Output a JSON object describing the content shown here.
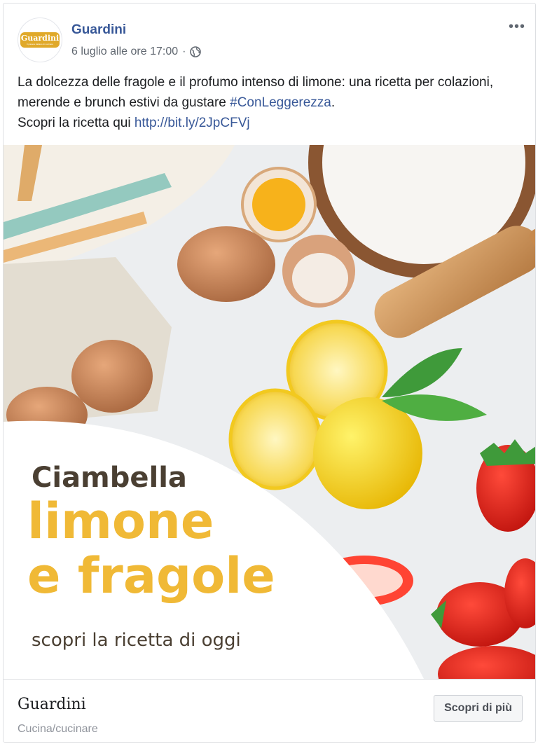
{
  "post": {
    "page_name": "Guardini",
    "timestamp": "6 luglio alle ore 17:00",
    "separator": "·",
    "more_label": "•••",
    "text_main": "La dolcezza delle fragole e il profumo intenso di limone: una ricetta per colazioni, merende e brunch estivi da gustare ",
    "hashtag": "#ConLeggerezza",
    "text_after_hashtag": ".",
    "text_line3": "Scopri la ricetta qui ",
    "link": "http://bit.ly/2JpCFVj"
  },
  "logo": {
    "brand": "Guardini",
    "tagline": "Il piacere italiano di cucinare"
  },
  "image": {
    "title_line1": "Ciambella",
    "title_line2": "limone",
    "title_line3": "e fragole",
    "subtitle": "scopri la ricetta di oggi"
  },
  "footer": {
    "title": "Guardini",
    "category": "Cucina/cucinare",
    "cta_label": "Scopri di più"
  },
  "colors": {
    "link": "#385898",
    "accent": "#f0b936",
    "headline_dark": "#4a3f32"
  }
}
